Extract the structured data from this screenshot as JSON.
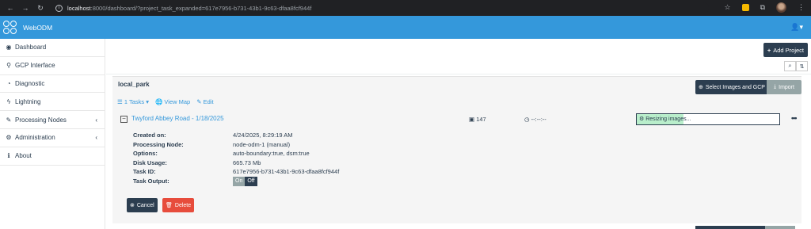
{
  "browser": {
    "url_host": "localhost",
    "url_rest": ":8000/dashboard/?project_task_expanded=617e7956-b731-43b1-9c63-dfaa8fcf944f"
  },
  "app": {
    "name": "WebODM"
  },
  "sidebar": {
    "items": [
      {
        "label": "Dashboard",
        "icon": "dashboard-icon"
      },
      {
        "label": "GCP Interface",
        "icon": "map-marker-icon"
      },
      {
        "label": "Diagnostic",
        "icon": "pie-chart-icon"
      },
      {
        "label": "Lightning",
        "icon": "bolt-icon"
      },
      {
        "label": "Processing Nodes",
        "icon": "wrench-icon"
      },
      {
        "label": "Administration",
        "icon": "cogs-icon"
      },
      {
        "label": "About",
        "icon": "info-icon"
      }
    ]
  },
  "toolbar": {
    "add_project": "Add Project"
  },
  "project": {
    "name": "local_park",
    "select_images_label": "Select Images and GCP",
    "import_label": "Import",
    "tasks_label": "1 Tasks",
    "view_map_label": "View Map",
    "edit_label": "Edit"
  },
  "task": {
    "name": "Twyford Abbey Road - 1/18/2025",
    "image_count": "147",
    "elapsed": "--:--:--",
    "status": "Resizing images...",
    "progress": 0.33,
    "details": [
      {
        "key": "Created on:",
        "value": "4/24/2025, 8:29:19 AM"
      },
      {
        "key": "Processing Node:",
        "value": "node-odm-1 (manual)"
      },
      {
        "key": "Options:",
        "value": "auto-boundary:true, dsm:true"
      },
      {
        "key": "Disk Usage:",
        "value": "665.73 Mb"
      },
      {
        "key": "Task ID:",
        "value": "617e7956-b731-43b1-9c63-dfaa8fcf944f"
      },
      {
        "key": "Task Output:",
        "value": ""
      }
    ],
    "output_on": "On",
    "output_off": "Off",
    "cancel_label": "Cancel",
    "delete_label": "Delete"
  },
  "colors": {
    "brand": "#3498db",
    "dark": "#2c3e50",
    "danger": "#e74c3c",
    "progress": "#b9eecb"
  }
}
